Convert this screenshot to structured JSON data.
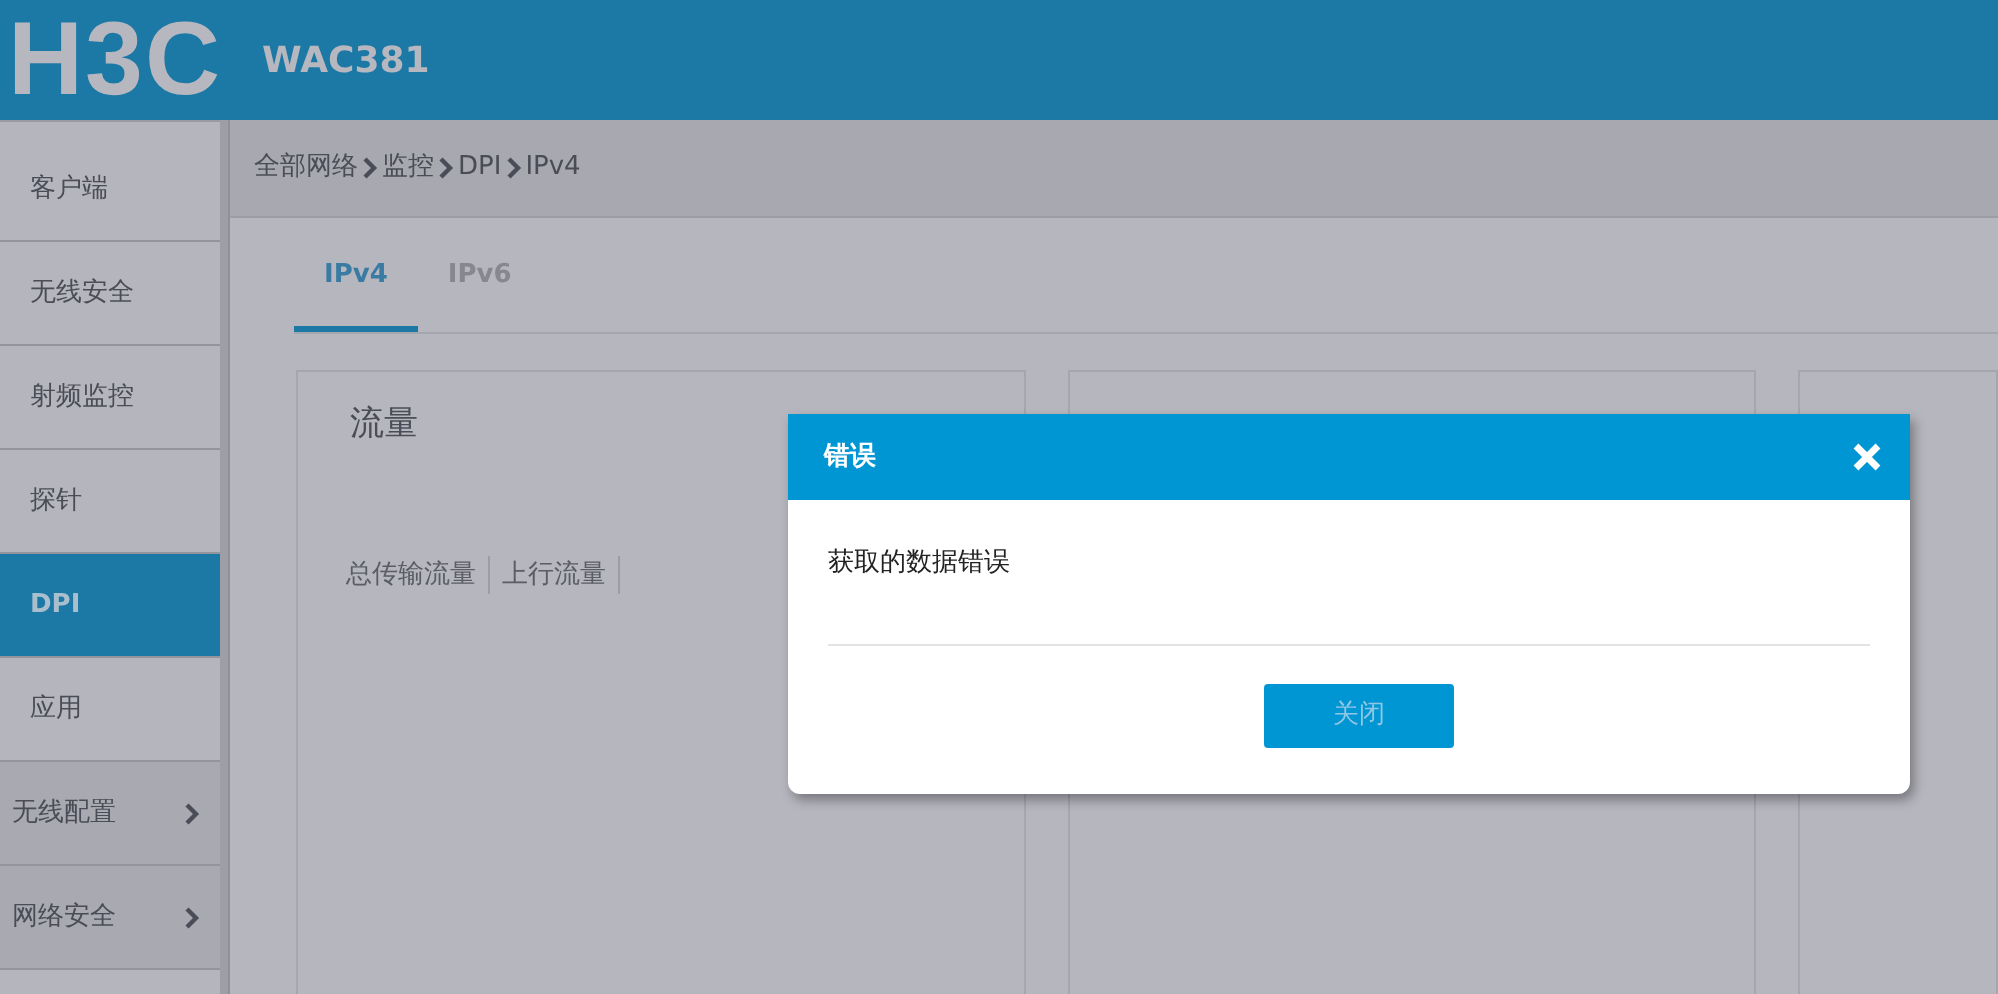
{
  "header": {
    "logo": "H3C",
    "model": "WAC381"
  },
  "sidebar": {
    "items": [
      {
        "label": "客户端",
        "kind": "sub",
        "selected": false
      },
      {
        "label": "无线安全",
        "kind": "sub",
        "selected": false
      },
      {
        "label": "射频监控",
        "kind": "sub",
        "selected": false
      },
      {
        "label": "探针",
        "kind": "sub",
        "selected": false
      },
      {
        "label": "DPI",
        "kind": "sub",
        "selected": true
      },
      {
        "label": "应用",
        "kind": "sub",
        "selected": false
      },
      {
        "label": "无线配置",
        "kind": "group",
        "selected": false
      },
      {
        "label": "网络安全",
        "kind": "group",
        "selected": false
      }
    ]
  },
  "breadcrumb": [
    "全部网络",
    "监控",
    "DPI",
    "IPv4"
  ],
  "tabs": [
    {
      "label": "IPv4",
      "selected": true
    },
    {
      "label": "IPv6",
      "selected": false
    }
  ],
  "cards": [
    {
      "kind": "stats",
      "title": "流量",
      "metrics": [
        "总传输流量",
        "上行流量"
      ]
    },
    {
      "kind": "blank"
    },
    {
      "kind": "blank"
    }
  ],
  "modal": {
    "title": "错误",
    "message": "获取的数据错误",
    "button": "关闭"
  }
}
